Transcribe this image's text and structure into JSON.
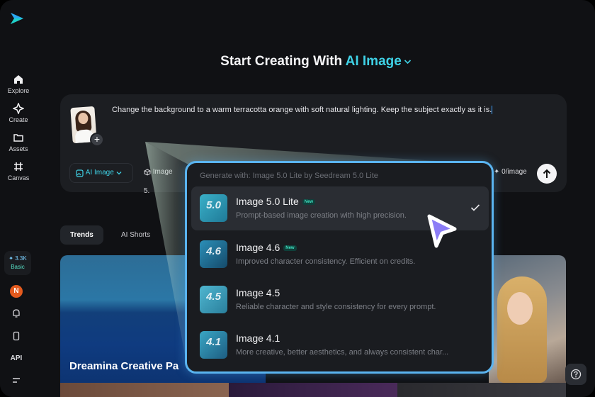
{
  "sidebar": {
    "items": [
      {
        "label": "Explore",
        "icon": "home-icon"
      },
      {
        "label": "Create",
        "icon": "sparkle-icon"
      },
      {
        "label": "Assets",
        "icon": "folder-icon"
      },
      {
        "label": "Canvas",
        "icon": "canvas-icon"
      }
    ],
    "credits": {
      "amount": "✦ 3.3K",
      "plan": "Basic"
    },
    "avatar_initial": "N",
    "api_label": "API"
  },
  "header": {
    "title_prefix": "Start Creating With",
    "title_accent": "AI Image"
  },
  "prompt": {
    "text": "Change the background to a warm terracotta orange with soft natural lighting. Keep the subject exactly as it is.",
    "model_pill": "AI Image",
    "image_pill": "Image 5.",
    "cost": "0/image"
  },
  "tabs": [
    {
      "label": "Trends",
      "active": true
    },
    {
      "label": "AI Shorts",
      "active": false
    }
  ],
  "gallery": {
    "main_card_title": "Dreamina Creative Pa"
  },
  "dropdown": {
    "header": "Generate with: Image 5.0 Lite by Seedream 5.0 Lite",
    "options": [
      {
        "name": "Image 5.0 Lite",
        "badge": "New",
        "version": "5.0",
        "desc": "Prompt-based image creation with high precision.",
        "selected": true
      },
      {
        "name": "Image 4.6",
        "badge": "New",
        "version": "4.6",
        "desc": "Improved character consistency. Efficient on credits.",
        "selected": false
      },
      {
        "name": "Image 4.5",
        "badge": "",
        "version": "4.5",
        "desc": "Reliable character and style consistency for every prompt.",
        "selected": false
      },
      {
        "name": "Image 4.1",
        "badge": "",
        "version": "4.1",
        "desc": "More creative, better aesthetics, and always consistent char...",
        "selected": false
      }
    ]
  },
  "colors": {
    "accent": "#3fd2e6",
    "highlight_border": "#5ab4f0",
    "cursor": "#8b7cf6"
  }
}
